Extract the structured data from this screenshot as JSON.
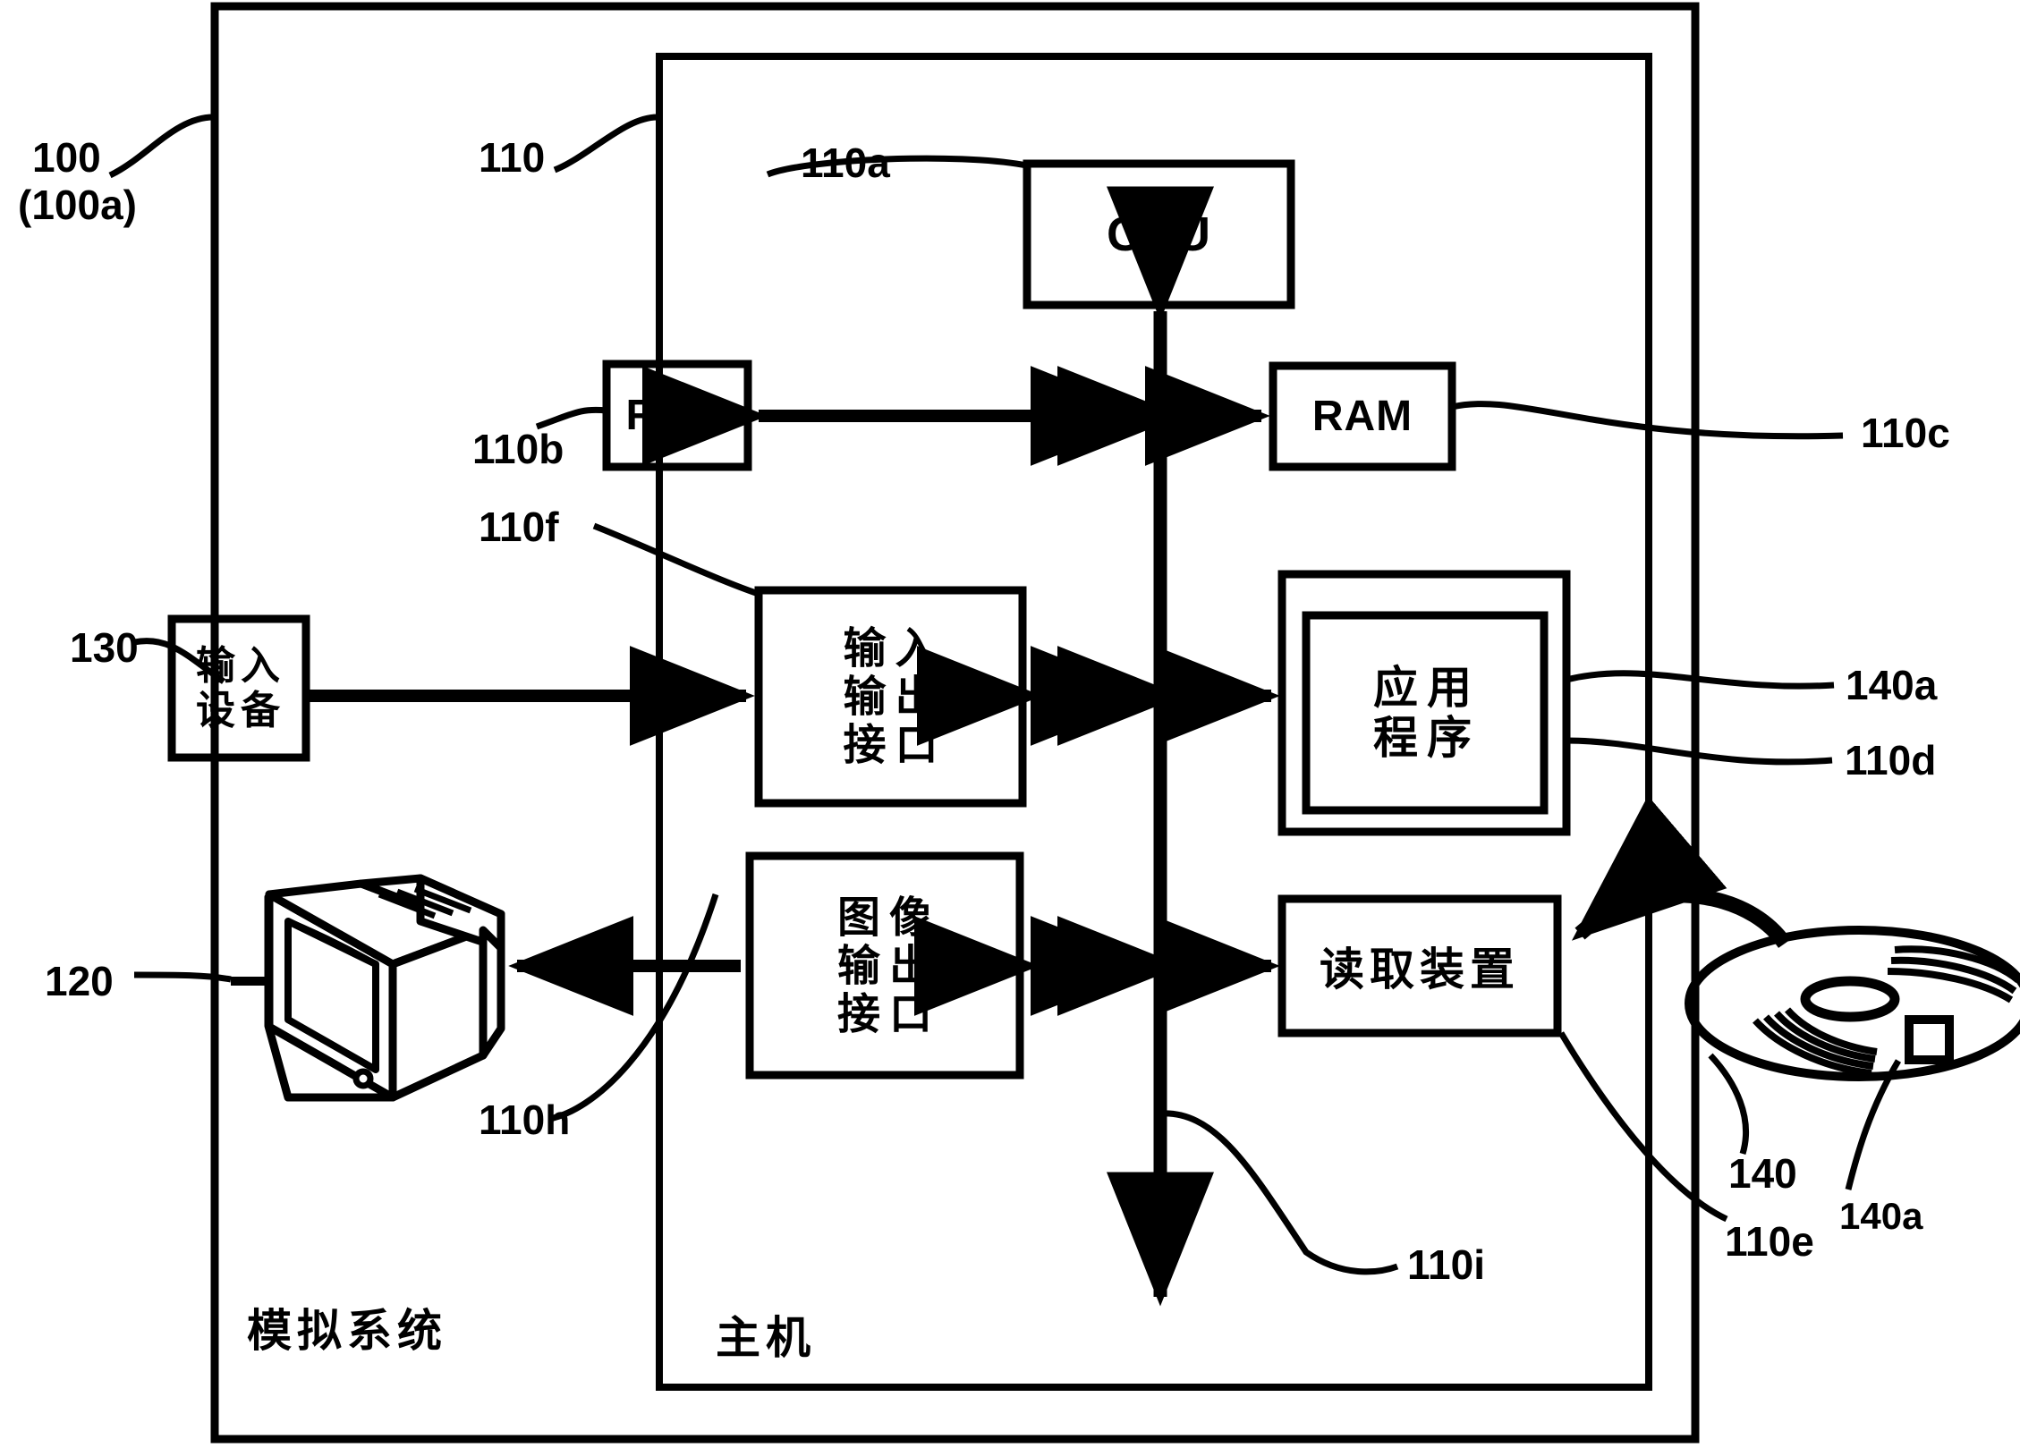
{
  "figure": {
    "type": "patent-block-diagram",
    "language": "zh-CN"
  },
  "frames": {
    "outer": {
      "ref": "100",
      "ref_alt": "(100a)",
      "caption": "模拟系统"
    },
    "inner": {
      "ref": "110",
      "caption": "主机"
    }
  },
  "blocks": {
    "cpu": {
      "label": "CPU",
      "ref": "110a"
    },
    "rom": {
      "label": "ROM",
      "ref": "110b"
    },
    "ram": {
      "label": "RAM",
      "ref": "110c"
    },
    "io": {
      "label_cells": [
        "输",
        "入",
        "输",
        "出",
        "接",
        "口"
      ],
      "ref": "110f"
    },
    "video": {
      "label_cells": [
        "图",
        "像",
        "输",
        "出",
        "接",
        "口"
      ],
      "ref": "110h"
    },
    "input_dev": {
      "label_line1": "输入",
      "label_line2": "设备",
      "ref": "130"
    },
    "app": {
      "label_line1": "应用",
      "label_line2": "程序",
      "ref_outer": "110d",
      "ref_inner": "140a"
    },
    "reader": {
      "label": "读取装置",
      "ref": "110e"
    },
    "display": {
      "ref": "120"
    },
    "disc": {
      "ref": "140",
      "marker_ref": "140a"
    },
    "bus": {
      "ref": "110i"
    }
  },
  "refs": {
    "r100": "100",
    "r100a": "(100a)",
    "r110": "110",
    "r110a": "110a",
    "r110b": "110b",
    "r110c": "110c",
    "r110d": "110d",
    "r110e": "110e",
    "r110f": "110f",
    "r110h": "110h",
    "r110i": "110i",
    "r120": "120",
    "r130": "130",
    "r140": "140",
    "r140a_top": "140a",
    "r140a_bottom": "140a"
  },
  "colors": {
    "ink": "#000000",
    "paper": "#ffffff"
  }
}
